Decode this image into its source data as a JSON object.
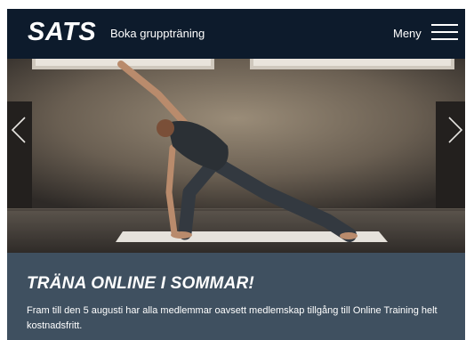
{
  "header": {
    "logo": "SATS",
    "book_link": "Boka gruppträning",
    "menu_label": "Meny"
  },
  "hero": {
    "image": "woman-doing-yoga-side-angle-pose-on-mat",
    "prev_icon": "chevron-left-icon",
    "next_icon": "chevron-right-icon"
  },
  "promo": {
    "title": "TRÄNA ONLINE I SOMMAR!",
    "text": "Fram till den 5 augusti har alla medlemmar oavsett medlemskap tillgång till Online Training helt kostnadsfritt."
  },
  "colors": {
    "header_bg": "#0d1b2c",
    "caption_bg": "#3f5060",
    "text": "#ffffff"
  }
}
